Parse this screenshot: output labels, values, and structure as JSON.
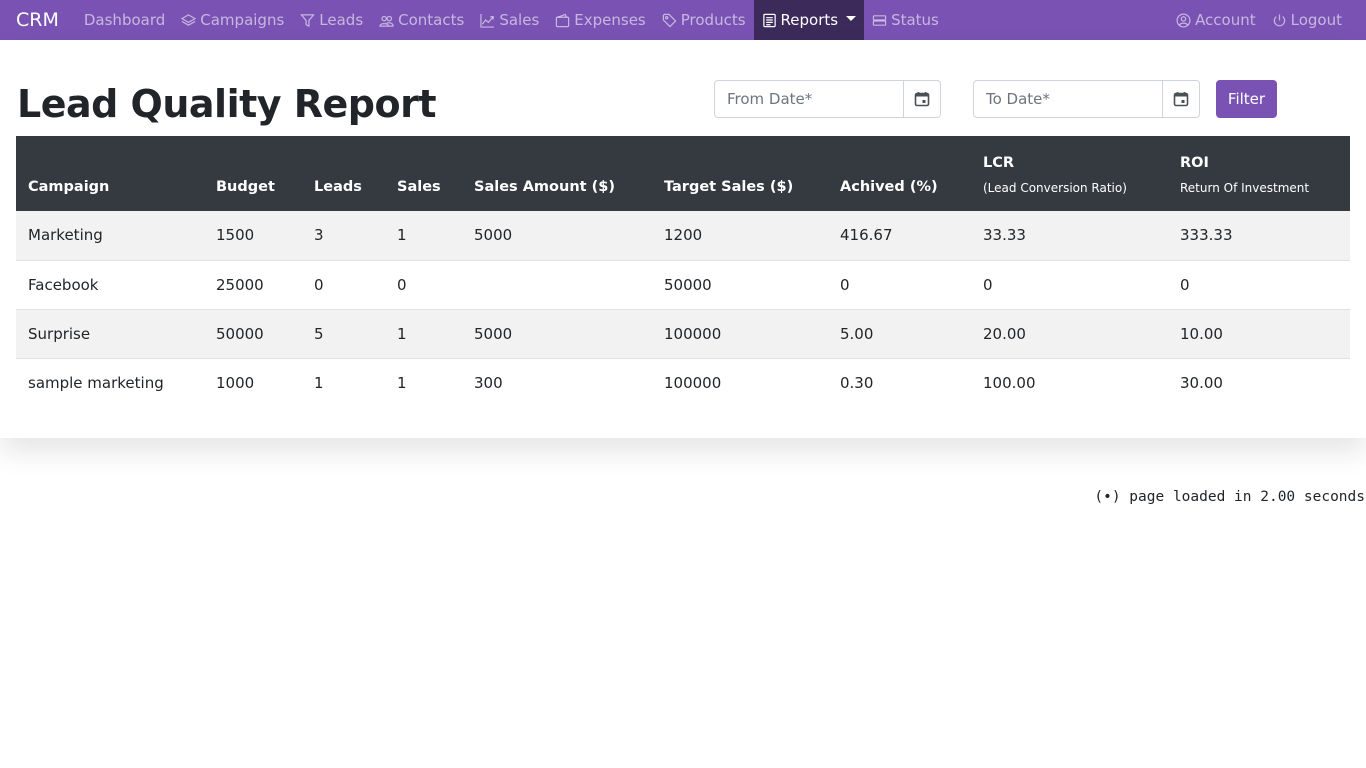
{
  "nav": {
    "brand": "CRM",
    "items": [
      {
        "label": "Dashboard",
        "icon": "none"
      },
      {
        "label": "Campaigns",
        "icon": "layers-icon"
      },
      {
        "label": "Leads",
        "icon": "funnel-icon"
      },
      {
        "label": "Contacts",
        "icon": "people-icon"
      },
      {
        "label": "Sales",
        "icon": "graph-up-icon"
      },
      {
        "label": "Expenses",
        "icon": "wallet-icon"
      },
      {
        "label": "Products",
        "icon": "tag-icon"
      },
      {
        "label": "Reports",
        "icon": "document-icon",
        "active": true,
        "dropdown": true
      },
      {
        "label": "Status",
        "icon": "server-icon"
      }
    ],
    "right": [
      {
        "label": "Account",
        "icon": "user-circle-icon"
      },
      {
        "label": "Logout",
        "icon": "power-icon"
      }
    ],
    "color": "#7952b3",
    "active_color": "#3c2a5a"
  },
  "page": {
    "title": "Lead Quality Report"
  },
  "filters": {
    "from_placeholder": "From Date*",
    "to_placeholder": "To Date*",
    "filter_label": "Filter"
  },
  "table": {
    "headers": [
      {
        "label": "Campaign",
        "sub": ""
      },
      {
        "label": "Budget",
        "sub": ""
      },
      {
        "label": "Leads",
        "sub": ""
      },
      {
        "label": "Sales",
        "sub": ""
      },
      {
        "label": "Sales Amount ($)",
        "sub": ""
      },
      {
        "label": "Target Sales ($)",
        "sub": ""
      },
      {
        "label": "Achived (%)",
        "sub": ""
      },
      {
        "label": "LCR",
        "sub": "(Lead Conversion Ratio)"
      },
      {
        "label": "ROI",
        "sub": "Return Of Investment"
      }
    ],
    "rows": [
      [
        "Marketing",
        "1500",
        "3",
        "1",
        "5000",
        "1200",
        "416.67",
        "33.33",
        "333.33"
      ],
      [
        "Facebook",
        "25000",
        "0",
        "0",
        "",
        "50000",
        "0",
        "0",
        "0"
      ],
      [
        "Surprise",
        "50000",
        "5",
        "1",
        "5000",
        "100000",
        "5.00",
        "20.00",
        "10.00"
      ],
      [
        "sample marketing",
        "1000",
        "1",
        "1",
        "300",
        "100000",
        "0.30",
        "100.00",
        "30.00"
      ]
    ]
  },
  "footer": {
    "icon": "broadcast-icon",
    "text": "page loaded in 2.00 seconds"
  }
}
